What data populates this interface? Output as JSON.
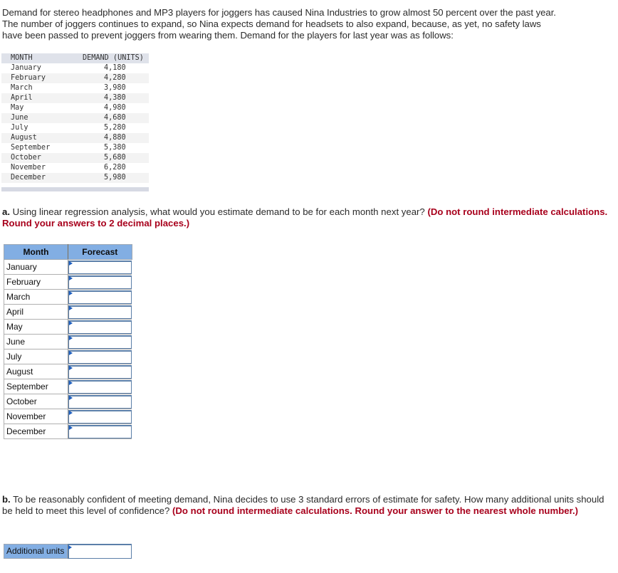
{
  "intro": {
    "lines": [
      "Demand for stereo headphones and MP3 players for joggers has caused Nina Industries to grow almost 50 percent over the past year.",
      "The number of joggers continues to expand, so Nina expects demand for headsets to also expand, because, as yet, no safety laws",
      "have been passed to prevent joggers from wearing them. Demand for the players for last year was as follows:"
    ]
  },
  "demand_table": {
    "headers": [
      "MONTH",
      "DEMAND (UNITS)"
    ],
    "rows": [
      {
        "month": "January",
        "demand": "4,180"
      },
      {
        "month": "February",
        "demand": "4,280"
      },
      {
        "month": "March",
        "demand": "3,980"
      },
      {
        "month": "April",
        "demand": "4,380"
      },
      {
        "month": "May",
        "demand": "4,980"
      },
      {
        "month": "June",
        "demand": "4,680"
      },
      {
        "month": "July",
        "demand": "5,280"
      },
      {
        "month": "August",
        "demand": "4,880"
      },
      {
        "month": "September",
        "demand": "5,380"
      },
      {
        "month": "October",
        "demand": "5,680"
      },
      {
        "month": "November",
        "demand": "6,280"
      },
      {
        "month": "December",
        "demand": "5,980"
      }
    ]
  },
  "part_a": {
    "label": "a.",
    "text": " Using linear regression analysis, what would you estimate demand to be for each month next year? ",
    "note": "(Do not round intermediate calculations. Round your answers to 2 decimal places.)",
    "table": {
      "headers": [
        "Month",
        "Forecast"
      ],
      "rows": [
        {
          "month": "January",
          "value": ""
        },
        {
          "month": "February",
          "value": ""
        },
        {
          "month": "March",
          "value": ""
        },
        {
          "month": "April",
          "value": ""
        },
        {
          "month": "May",
          "value": ""
        },
        {
          "month": "June",
          "value": ""
        },
        {
          "month": "July",
          "value": ""
        },
        {
          "month": "August",
          "value": ""
        },
        {
          "month": "September",
          "value": ""
        },
        {
          "month": "October",
          "value": ""
        },
        {
          "month": "November",
          "value": ""
        },
        {
          "month": "December",
          "value": ""
        }
      ]
    }
  },
  "part_b": {
    "label": "b.",
    "text": " To be reasonably confident of meeting demand, Nina decides to use 3 standard errors of estimate for safety. How many additional units should be held to meet this level of confidence? ",
    "note": "(Do not round intermediate calculations. Round your answer to the nearest whole number.)",
    "field_label": "Additional units",
    "field_value": ""
  },
  "colors": {
    "header_blue": "#82aee3",
    "note_red": "#a8001c",
    "input_border": "#5b7fa9",
    "flag_blue": "#1f5fbf"
  }
}
